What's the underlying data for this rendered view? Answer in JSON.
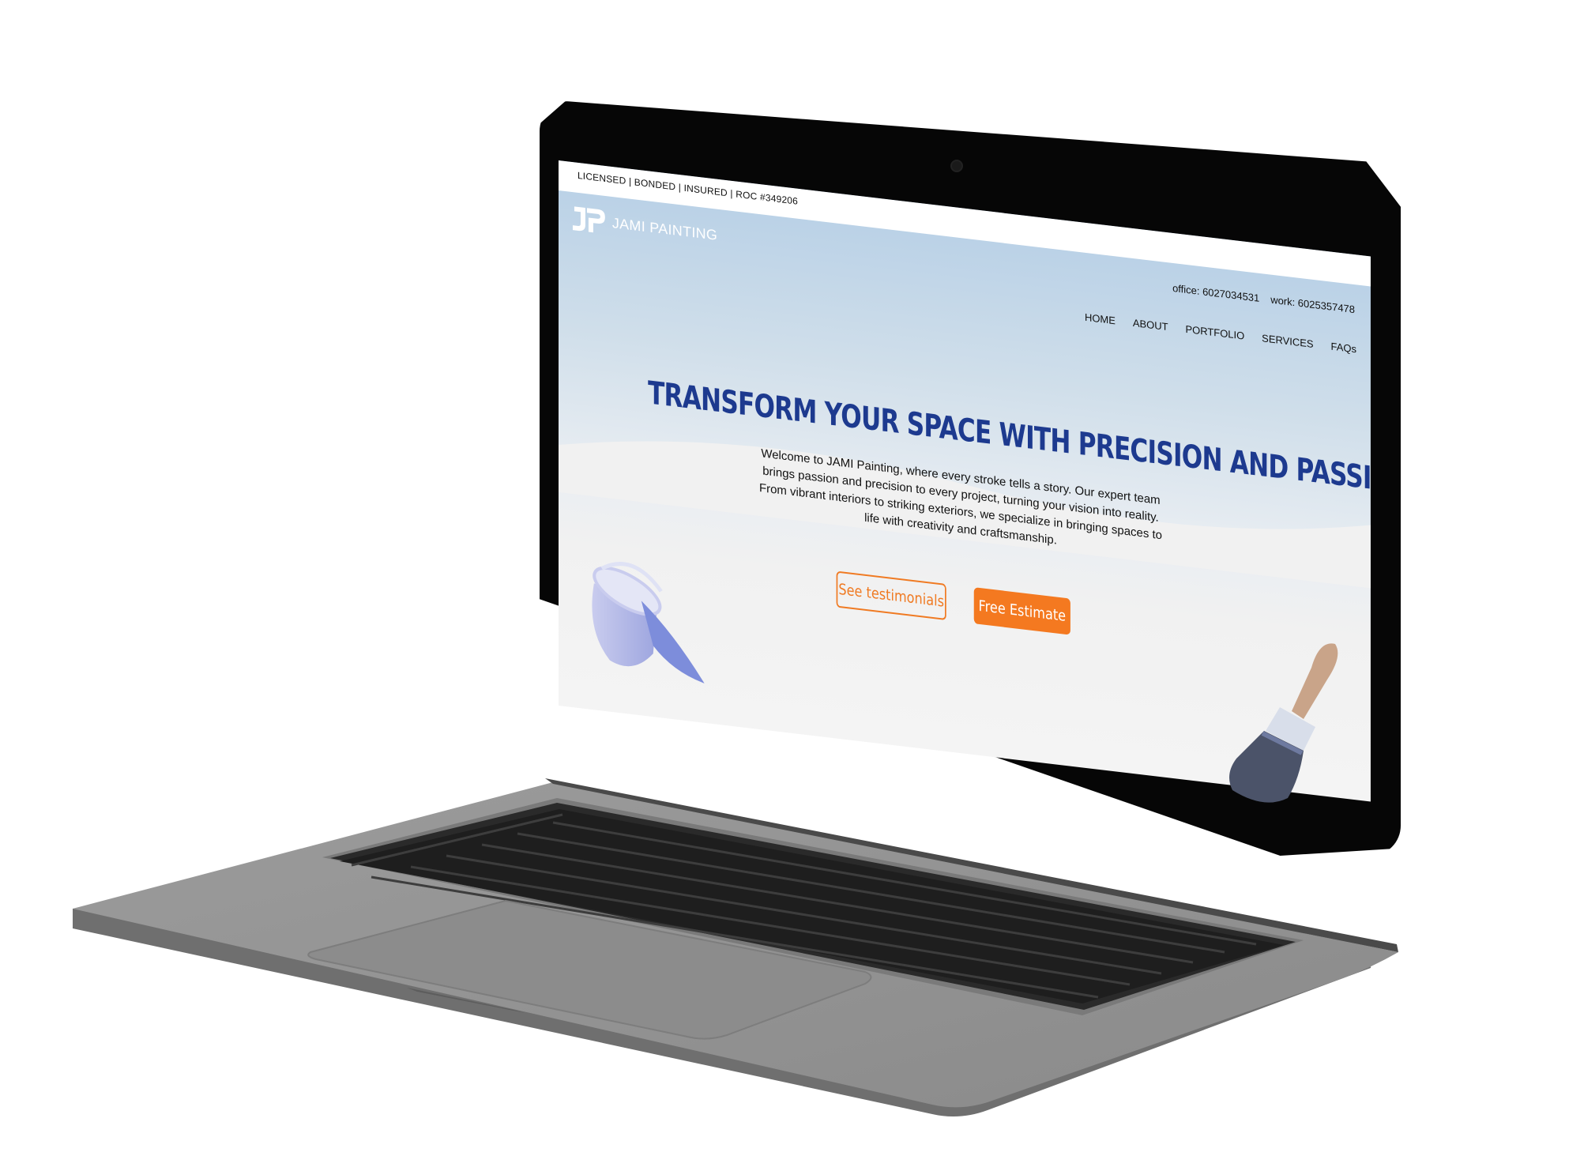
{
  "topbar": {
    "license_text": "LICENSED | BONDED | INSURED | ROC #349206"
  },
  "header": {
    "logo_name": "JAMI PAINTING",
    "office": "office: 6027034531",
    "work": "work: 6025357478"
  },
  "nav": {
    "home": "HOME",
    "about": "ABOUT",
    "portfolio": "PORTFOLIO",
    "services": "SERVICES",
    "faqs": "FAQs"
  },
  "hero": {
    "title": "TRANSFORM YOUR SPACE WITH PRECISION AND PASSION",
    "body": "Welcome to JAMI Painting, where every stroke tells a story. Our expert team brings passion and precision to every project, turning your vision into reality. From vibrant interiors to striking exteriors, we specialize in bringing spaces to life with creativity and craftsmanship.",
    "testimonials_label": "See testimonials",
    "estimate_label": "Free Estimate"
  },
  "colors": {
    "accent_orange": "#f47920",
    "title_blue": "#1d3a8f",
    "sky_top": "#b6cfe6",
    "laptop_silver": "#8f8f8f",
    "bezel": "#060606"
  },
  "icons": [
    "jp-logo-icon",
    "paint-bucket-icon",
    "paint-brush-icon"
  ]
}
